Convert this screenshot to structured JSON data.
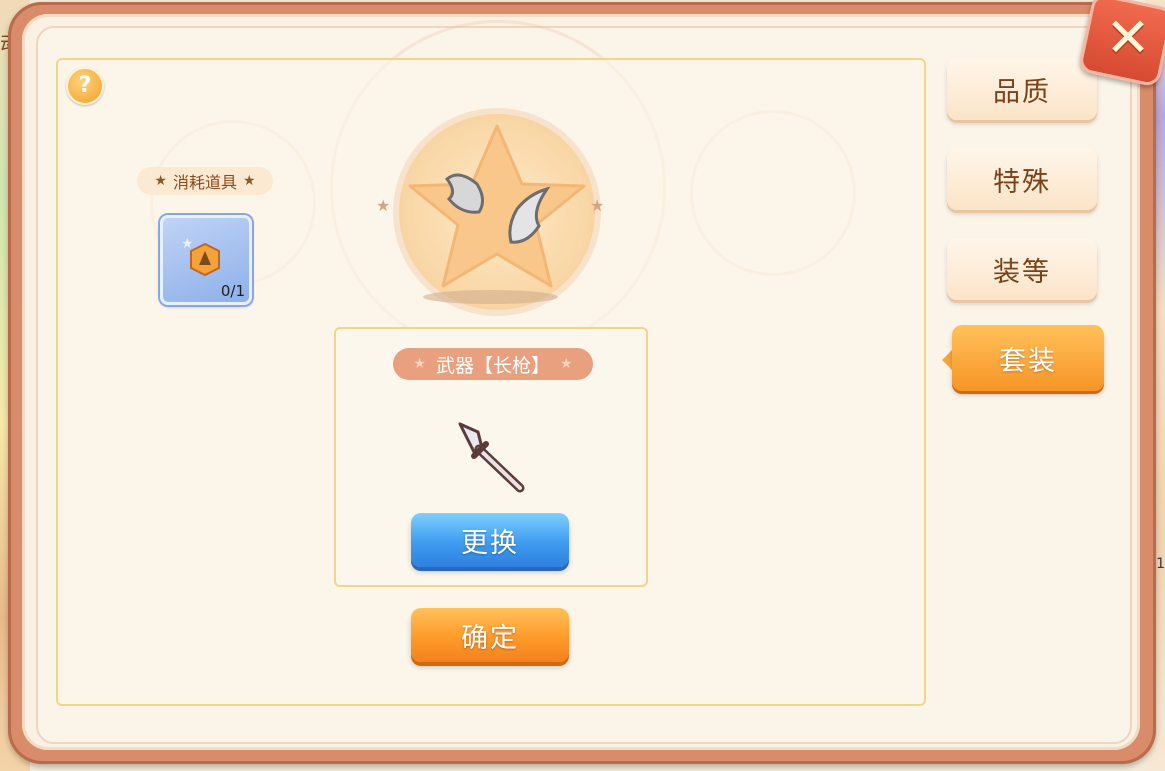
{
  "background": {
    "left_text": "动",
    "right_text": "1"
  },
  "help": {
    "symbol": "?"
  },
  "consumables": {
    "label": "消耗道具",
    "item": {
      "count": "0/1"
    }
  },
  "weapon": {
    "label": "武器【长枪】",
    "replace_button": "更换"
  },
  "confirm_button": "确定",
  "tabs": [
    {
      "label": "品质",
      "active": false
    },
    {
      "label": "特殊",
      "active": false
    },
    {
      "label": "装等",
      "active": false
    },
    {
      "label": "套装",
      "active": true
    }
  ],
  "close": {
    "symbol": "✕"
  },
  "colors": {
    "accent_orange": "#f79527",
    "accent_blue": "#3f9cf0",
    "frame": "#d88c6a"
  }
}
